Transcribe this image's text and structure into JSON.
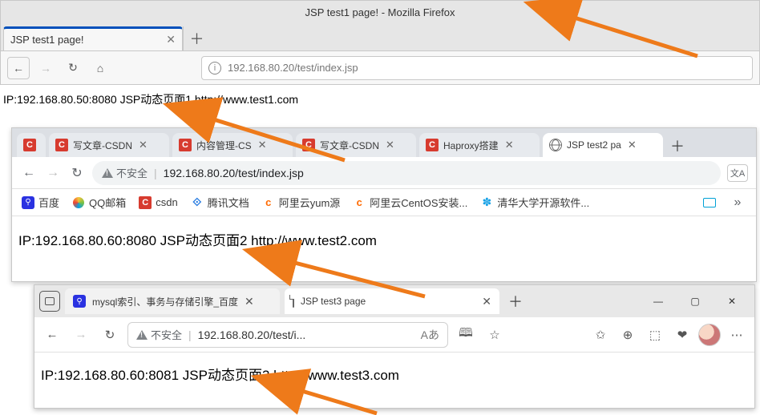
{
  "firefox": {
    "window_title": "JSP test1 page! - Mozilla Firefox",
    "tab_title": "JSP test1 page!",
    "url": "192.168.80.20/test/index.jsp",
    "page_text": "IP:192.168.80.50:8080 JSP动态页面1 http://www.test1.com"
  },
  "chrome": {
    "tabs": [
      {
        "label": "",
        "fav": "c"
      },
      {
        "label": "写文章-CSDN",
        "fav": "c"
      },
      {
        "label": "内容管理-CS",
        "fav": "c"
      },
      {
        "label": "写文章-CSDN",
        "fav": "c"
      },
      {
        "label": "Haproxy搭建",
        "fav": "c"
      },
      {
        "label": "JSP test2 pa",
        "fav": "globe",
        "active": true
      }
    ],
    "insecure": "不安全",
    "url": "192.168.80.20/test/index.jsp",
    "bookmarks": [
      {
        "icon": "baidu",
        "label": "百度"
      },
      {
        "icon": "qq",
        "label": "QQ邮箱"
      },
      {
        "icon": "c",
        "label": "csdn"
      },
      {
        "icon": "teng",
        "label": "腾讯文档"
      },
      {
        "icon": "ali",
        "label": "阿里云yum源"
      },
      {
        "icon": "ali",
        "label": "阿里云CentOS安装..."
      },
      {
        "icon": "th",
        "label": "清华大学开源软件..."
      }
    ],
    "overflow": "»",
    "page_text": "IP:192.168.80.60:8080 JSP动态页面2 http://www.test2.com"
  },
  "edge": {
    "tabs": [
      {
        "label": "mysql索引、事务与存储引擎_百度",
        "fav": "baidu"
      },
      {
        "label": "JSP test3 page",
        "fav": "doc",
        "active": true
      }
    ],
    "insecure": "不安全",
    "url": "192.168.80.20/test/i...",
    "reader": "Aあ",
    "page_text": "IP:192.168.80.60:8081 JSP动态页面3 http://www.test3.com"
  }
}
